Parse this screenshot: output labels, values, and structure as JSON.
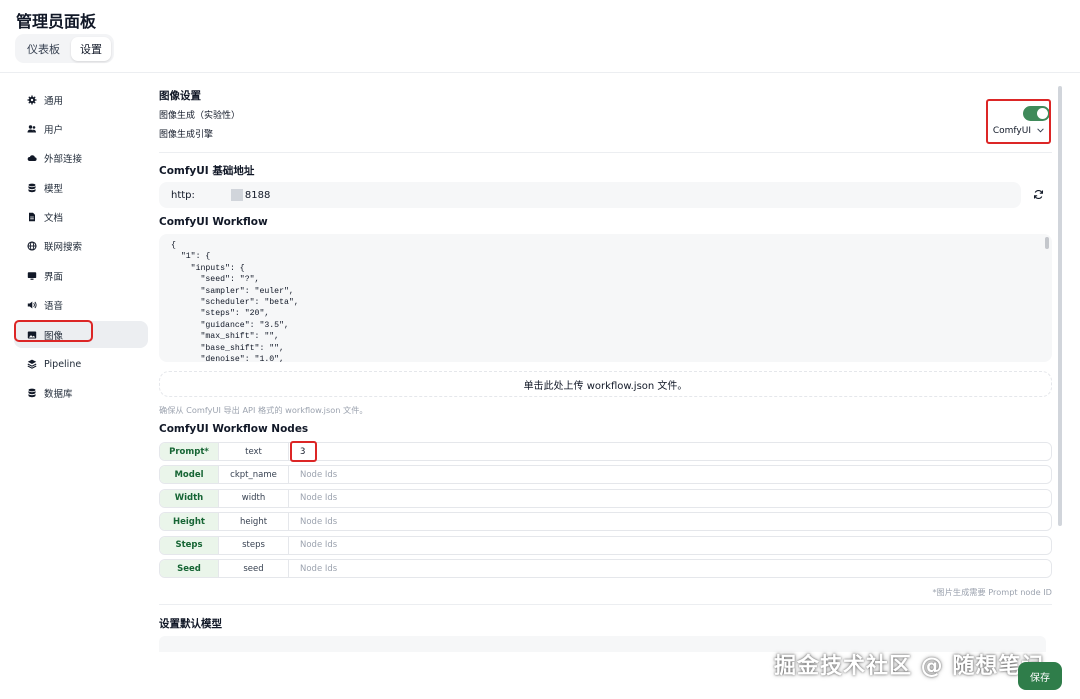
{
  "header": {
    "title": "管理员面板",
    "tabs": [
      {
        "label": "仪表板",
        "active": false
      },
      {
        "label": "设置",
        "active": true
      }
    ]
  },
  "sidebar": {
    "items": [
      {
        "label": "通用",
        "icon": "gear-icon"
      },
      {
        "label": "用户",
        "icon": "users-icon"
      },
      {
        "label": "外部连接",
        "icon": "cloud-icon"
      },
      {
        "label": "模型",
        "icon": "database-icon"
      },
      {
        "label": "文档",
        "icon": "document-icon"
      },
      {
        "label": "联网搜索",
        "icon": "globe-icon"
      },
      {
        "label": "界面",
        "icon": "monitor-icon"
      },
      {
        "label": "语音",
        "icon": "speaker-icon"
      },
      {
        "label": "图像",
        "icon": "image-icon",
        "active": true
      },
      {
        "label": "Pipeline",
        "icon": "pipeline-icon"
      },
      {
        "label": "数据库",
        "icon": "database-icon"
      }
    ]
  },
  "image_settings": {
    "section_title": "图像设置",
    "generation_label": "图像生成（实验性）",
    "generation_enabled": true,
    "engine_label": "图像生成引擎",
    "engine_value": "ComfyUI"
  },
  "comfyui": {
    "base_url_title": "ComfyUI 基础地址",
    "base_url_prefix": "http:",
    "base_url_suffix": "8188",
    "workflow_title": "ComfyUI Workflow",
    "workflow_lines": [
      "{",
      "  \"1\": {",
      "    \"inputs\": {",
      "      \"seed\": \"?\",",
      "      \"sampler\": \"euler\",",
      "      \"scheduler\": \"beta\",",
      "      \"steps\": \"20\",",
      "      \"guidance\": \"3.5\",",
      "      \"max_shift\": \"\",",
      "      \"base_shift\": \"\",",
      "      \"denoise\": \"1.0\","
    ],
    "upload_label": "单击此处上传 workflow.json 文件。",
    "upload_hint": "确保从 ComfyUI 导出 API 格式的 workflow.json 文件。",
    "nodes_title": "ComfyUI Workflow Nodes",
    "nodes": [
      {
        "tag": "Prompt*",
        "key": "text",
        "value": "3",
        "placeholder": "Node Ids"
      },
      {
        "tag": "Model",
        "key": "ckpt_name",
        "value": "",
        "placeholder": "Node Ids"
      },
      {
        "tag": "Width",
        "key": "width",
        "value": "",
        "placeholder": "Node Ids"
      },
      {
        "tag": "Height",
        "key": "height",
        "value": "",
        "placeholder": "Node Ids"
      },
      {
        "tag": "Steps",
        "key": "steps",
        "value": "",
        "placeholder": "Node Ids"
      },
      {
        "tag": "Seed",
        "key": "seed",
        "value": "",
        "placeholder": "Node Ids"
      }
    ],
    "nodes_note": "*图片生成需要 Prompt node ID"
  },
  "default_model": {
    "title": "设置默认模型"
  },
  "footer": {
    "save_label": "保存",
    "watermark": "掘金技术社区 @ 随想笔记"
  },
  "colors": {
    "accent_green": "#3f8a5a",
    "highlight_red": "#dc2626",
    "tag_bg": "#eaf5ea"
  }
}
